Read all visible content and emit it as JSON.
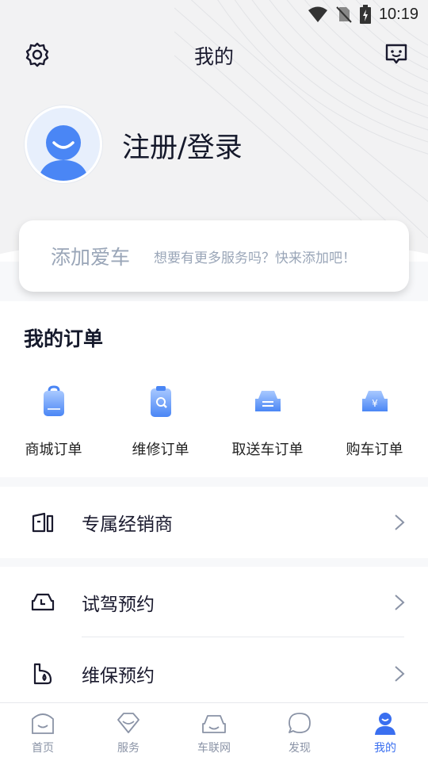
{
  "status_bar": {
    "time": "10:19"
  },
  "header": {
    "title": "我的"
  },
  "profile": {
    "login_label": "注册/登录"
  },
  "add_car": {
    "label": "添加爱车",
    "hint": "想要有更多服务吗？快来添加吧！"
  },
  "orders": {
    "title": "我的订单",
    "items": [
      {
        "label": "商城订单",
        "icon": "shopping-bag-icon"
      },
      {
        "label": "维修订单",
        "icon": "repair-clipboard-icon"
      },
      {
        "label": "取送车订单",
        "icon": "car-transfer-icon"
      },
      {
        "label": "购车订单",
        "icon": "car-purchase-icon"
      }
    ]
  },
  "menu": [
    {
      "label": "专属经销商",
      "icon": "dealer-icon"
    },
    {
      "label": "试驾预约",
      "icon": "test-drive-icon"
    },
    {
      "label": "维保预约",
      "icon": "maintenance-icon"
    }
  ],
  "tabs": [
    {
      "label": "首页",
      "icon": "home-icon"
    },
    {
      "label": "服务",
      "icon": "service-icon"
    },
    {
      "label": "车联网",
      "icon": "car-network-icon"
    },
    {
      "label": "发现",
      "icon": "discover-icon"
    },
    {
      "label": "我的",
      "icon": "profile-icon",
      "active": true
    }
  ],
  "colors": {
    "accent": "#3a6ff0",
    "icon_gradient_light": "#8ab4ff",
    "icon_gradient_dark": "#4a86f5"
  }
}
